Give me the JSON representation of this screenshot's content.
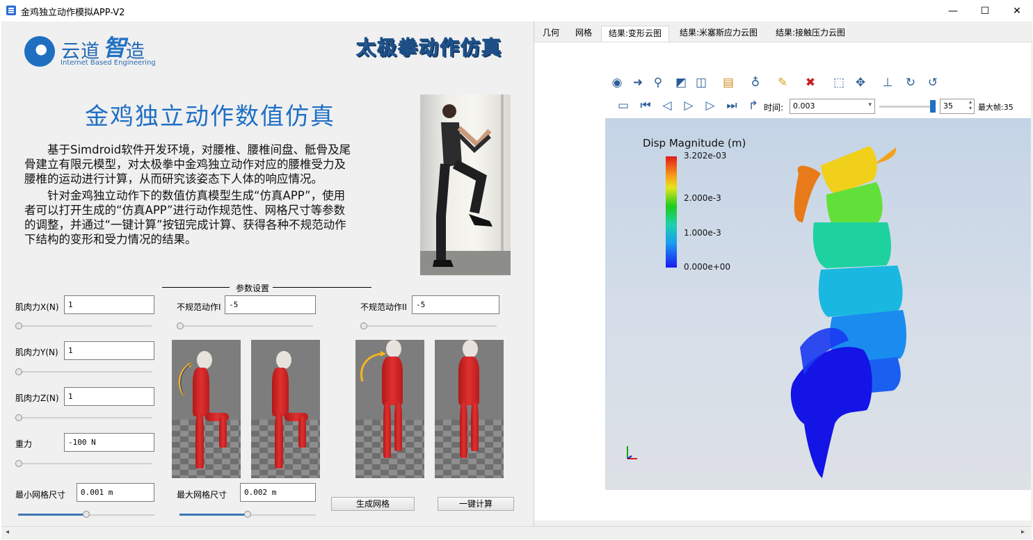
{
  "window": {
    "title": "金鸡独立动作模拟APP-V2",
    "minimize": "—",
    "maximize": "☐",
    "close": "✕"
  },
  "logo": {
    "chinese_a": "云道",
    "chinese_b": "智",
    "chinese_c": "造",
    "english": "Internet Based Engineering"
  },
  "banner_title": "太极拳动作仿真",
  "heading": "金鸡独立动作数值仿真",
  "description": {
    "p1_lines": [
      "　　基于Simdroid软件开发环境，对腰椎、腰椎间盘、骶骨及尾",
      "骨建立有限元模型，对太极拳中金鸡独立动作对应的腰椎受力及",
      "腰椎的运动进行计算，从而研究该姿态下人体的响应情况。"
    ],
    "p2_lines": [
      "　　针对金鸡独立动作下的数值仿真模型生成“仿真APP”，使用",
      "者可以打开生成的“仿真APP”进行动作规范性、网格尺寸等参数",
      "的调整，并通过“一键计算”按钮完成计算、获得各种不规范动作",
      "下结构的变形和受力情况的结果。"
    ]
  },
  "params": {
    "group_label": "参数设置",
    "muscle_x": {
      "label": "肌肉力X(N)",
      "value": "1"
    },
    "muscle_y": {
      "label": "肌肉力Y(N)",
      "value": "1"
    },
    "muscle_z": {
      "label": "肌肉力Z(N)",
      "value": "1"
    },
    "gravity": {
      "label": "重力",
      "value": "-100 N"
    },
    "min_mesh": {
      "label": "最小网格尺寸",
      "value": "0.001 m"
    },
    "irregular_1": {
      "label": "不规范动作I",
      "value": "-5"
    },
    "irregular_2": {
      "label": "不规范动作II",
      "value": "-5"
    },
    "max_mesh": {
      "label": "最大网格尺寸",
      "value": "0.002 m"
    },
    "slider_levels": {
      "muscle_x": 0,
      "muscle_y": 0,
      "muscle_z": 0,
      "gravity": 0,
      "irregular_1": 0,
      "irregular_2": 0,
      "min_mesh": 0.5,
      "max_mesh": 0.5
    }
  },
  "buttons": {
    "generate_mesh": "生成网格",
    "one_click_compute": "一键计算"
  },
  "tabs": [
    "几何",
    "网格",
    "结果:变形云图",
    "结果:米塞斯应力云图",
    "结果:接触压力云图"
  ],
  "active_tab": "结果:变形云图",
  "viewer": {
    "time_label": "时间:",
    "time_value": "0.003",
    "frame_value": "35",
    "max_frame_label": "最大帧:35",
    "legend": {
      "title": "Disp Magnitude (m)",
      "labels": [
        "3.202e-03",
        "2.000e-3",
        "1.000e-3",
        "0.000e+00"
      ]
    }
  },
  "colors": {
    "brand_blue": "#1f6fc5",
    "legend_max": "#e31a1a",
    "legend_min": "#1a1af0",
    "slider_fill": "#3c78b5"
  }
}
